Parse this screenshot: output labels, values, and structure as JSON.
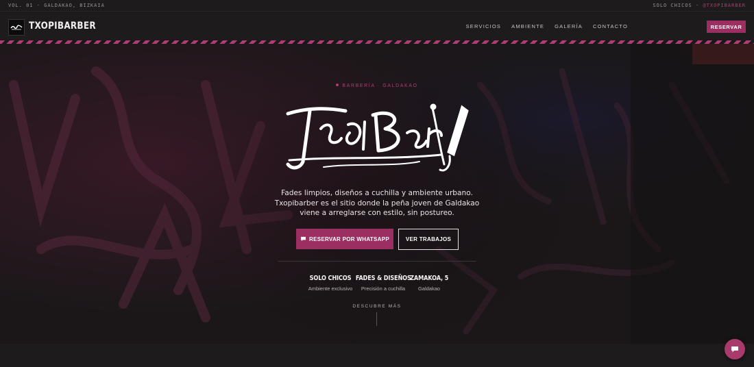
{
  "topbar": {
    "left_text": "VOL. 01 · GALDAKAO, BIZKAIA",
    "right_text": "SOLO CHICOS · ",
    "handle": "@TXOPIBARBER"
  },
  "nav": {
    "brand": "TXOPIBARBER",
    "links": [
      "SERVICIOS",
      "AMBIENTE",
      "GALERÍA",
      "CONTACTO"
    ],
    "cta": "RESERVAR"
  },
  "hero": {
    "eyebrow": "BARBERÍA · GALDAKAO",
    "logo_text": "TxopiBarber",
    "description": "Fades limpios, diseños a cuchilla y ambiente urbano. Txopibarber es el sitio donde la peña joven de Galdakao viene a arreglarse con estilo, sin postureo.",
    "primary_button": "RESERVAR POR WHATSAPP",
    "secondary_button": "VER TRABAJOS",
    "stats": [
      {
        "title": "SOLO CHICOS",
        "subtitle": "Ambiente exclusivo"
      },
      {
        "title": "FADES & DISEÑOS",
        "subtitle": "Precisión a cuchilla"
      },
      {
        "title": "ZAMAKOA, 5",
        "subtitle": "Galdakao"
      }
    ],
    "discover": "DESCUBRE MÁS"
  },
  "icons": {
    "whatsapp": "chat-bubble-icon",
    "fab": "chat-bubble-icon",
    "razor": "razor-icon"
  },
  "colors": {
    "accent": "#9c2f62",
    "accent_light": "#b23d72",
    "background": "#1a1818"
  }
}
